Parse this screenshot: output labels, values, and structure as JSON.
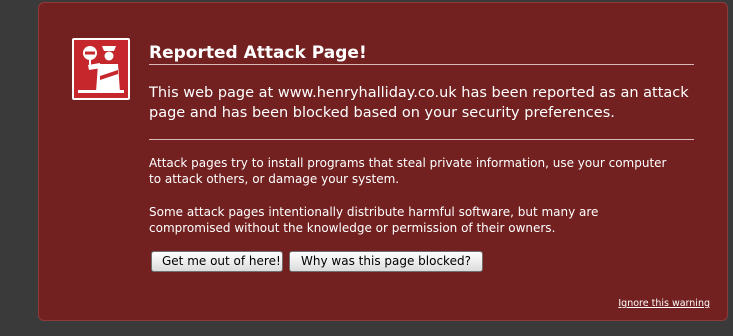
{
  "warning": {
    "title": "Reported Attack Page!",
    "lead": "This web page at www.henryhalliday.co.uk has been reported as an attack page and has been blocked based on your security preferences.",
    "paragraph_1": "Attack pages try to install programs that steal private information, use your computer to attack others, or damage your system.",
    "paragraph_2": "Some attack pages intentionally distribute harmful software, but many are compromised without the knowledge or permission of their owners.",
    "buttons": {
      "get_me_out": "Get me out of here!",
      "why_blocked": "Why was this page blocked?"
    },
    "ignore_link": "Ignore this warning",
    "icon": "police-officer-stop-icon"
  },
  "colors": {
    "panel_background": "#722020",
    "icon_background": "#c5272c",
    "page_background": "#3a3a3a",
    "text": "#ffffff"
  }
}
